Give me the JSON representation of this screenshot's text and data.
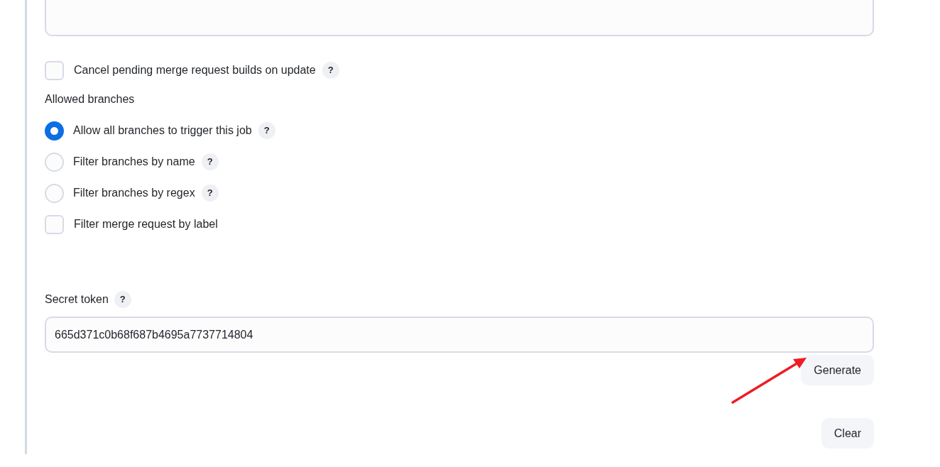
{
  "options": [
    {
      "kind": "checkbox",
      "label": "Cancel pending merge request builds on update",
      "checked": false,
      "help": "?"
    },
    {
      "kind": "heading",
      "label": "Allowed branches"
    },
    {
      "kind": "radio",
      "label": "Allow all branches to trigger this job",
      "selected": true,
      "help": "?"
    },
    {
      "kind": "radio",
      "label": "Filter branches by name",
      "selected": false,
      "help": "?"
    },
    {
      "kind": "radio",
      "label": "Filter branches by regex",
      "selected": false,
      "help": "?"
    },
    {
      "kind": "checkbox",
      "label": "Filter merge request by label",
      "checked": false
    }
  ],
  "secret_token": {
    "label": "Secret token",
    "help": "?",
    "value": "665d371c0b68f687b4695a7737714804"
  },
  "buttons": [
    {
      "label": "Generate",
      "kind": "generate"
    },
    {
      "label": "Clear",
      "kind": "clear"
    }
  ]
}
